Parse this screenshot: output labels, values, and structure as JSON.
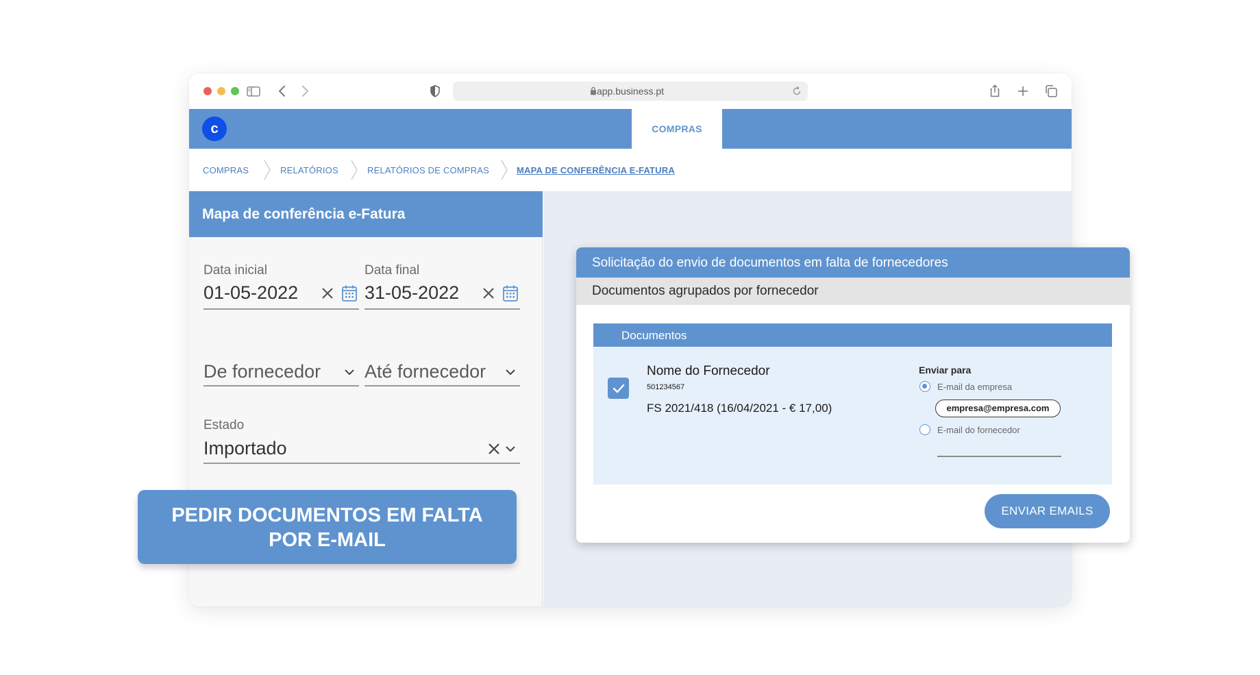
{
  "browser": {
    "url": "app.business.pt"
  },
  "app": {
    "logo_letter": "c",
    "active_tab": "COMPRAS"
  },
  "breadcrumb": {
    "items": [
      "COMPRAS",
      "RELATÓRIOS",
      "RELATÓRIOS DE COMPRAS",
      "MAPA DE CONFERÊNCIA E-FATURA"
    ]
  },
  "panel": {
    "title": "Mapa de conferência e-Fatura",
    "start_date": {
      "label": "Data inicial",
      "value": "01-05-2022"
    },
    "end_date": {
      "label": "Data final",
      "value": "31-05-2022"
    },
    "from_supplier": {
      "label": "De fornecedor"
    },
    "to_supplier": {
      "label": "Até fornecedor"
    },
    "status": {
      "label": "Estado",
      "value": "Importado"
    }
  },
  "action_button": {
    "line1": "PEDIR DOCUMENTOS EM FALTA",
    "line2": "POR E-MAIL"
  },
  "dialog": {
    "title": "Solicitação do envio de documentos em falta de fornecedores",
    "subtitle": "Documentos agrupados por fornecedor",
    "documents_header": "Documentos",
    "supplier": {
      "name": "Nome do Fornecedor",
      "nif": "501234567",
      "document": "FS 2021/418 (16/04/2021 - € 17,00)",
      "checked": true
    },
    "send_to": {
      "label": "Enviar para",
      "option_company": "E-mail da empresa",
      "company_email": "empresa@empresa.com",
      "option_supplier": "E-mail do fornecedor",
      "selected": "E-mail da empresa"
    },
    "send_button": "ENVIAR EMAILS"
  },
  "colors": {
    "primary": "#5f93cf",
    "logo": "#0e4fe8",
    "panel_bg": "#f7f7f7",
    "content_bg": "#e8edf4",
    "docs_bg": "#e6f0fb"
  }
}
